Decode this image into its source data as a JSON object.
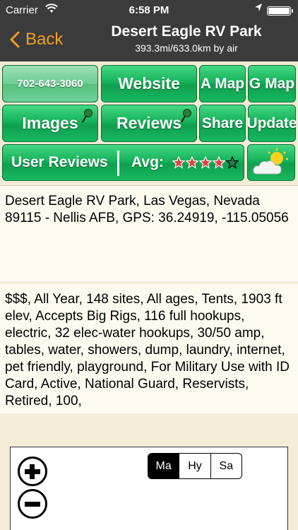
{
  "status": {
    "carrier": "Carrier",
    "time": "6:58 PM"
  },
  "nav": {
    "back_label": "Back",
    "title": "Desert Eagle RV Park",
    "subtitle": "393.3mi/633.0km by air"
  },
  "buttons": {
    "phone": "702-643-3060",
    "website": "Website",
    "amap": "A Map",
    "gmap": "G Map",
    "images": "Images",
    "reviews": "Reviews",
    "share": "Share",
    "update": "Update",
    "user_reviews": "User Reviews",
    "avg": "Avg:"
  },
  "rating": {
    "stars_filled": 4,
    "stars_total": 5
  },
  "address": "Desert Eagle RV Park, Las Vegas, Nevada 89115 - Nellis AFB, GPS: 36.24919, -115.05056",
  "details": "$$$, All Year, 148 sites, All ages, Tents, 1903 ft elev, Accepts Big Rigs, 116 full hookups, electric, 32 elec-water hookups, 30/50 amp, tables, water, showers, dump, laundry, internet, pet friendly, playground, For Military Use with ID Card, Active, National Guard, Reservists, Retired, 100,",
  "map": {
    "segments": [
      "Ma",
      "Hy",
      "Sa"
    ],
    "selected": "Ma"
  },
  "colors": {
    "accent": "#f0a020",
    "button_green": "#14b25a",
    "background": "#f5ecd7"
  }
}
